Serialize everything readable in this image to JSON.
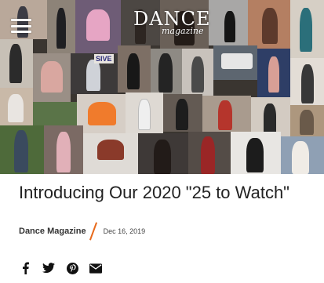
{
  "header": {
    "logo_main": "DANCE",
    "logo_sub": "magazine",
    "menu_icon": "hamburger-menu-icon",
    "sign_text": "SIVE"
  },
  "article": {
    "title": "Introducing Our 2020 \"25 to Watch\"",
    "author": "Dance Magazine",
    "date": "Dec 16, 2019"
  },
  "share": {
    "icons": [
      "facebook-icon",
      "twitter-icon",
      "pinterest-icon",
      "email-icon"
    ]
  },
  "colors": {
    "accent": "#e86a1c",
    "text": "#222222"
  }
}
